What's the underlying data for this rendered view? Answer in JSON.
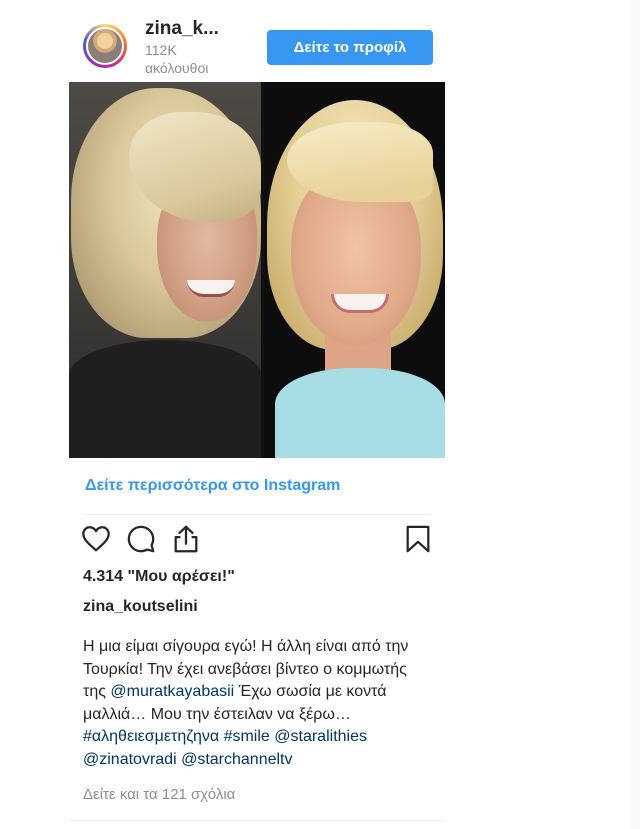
{
  "header": {
    "username": "zina_k...",
    "followers_count": "112K",
    "followers_label": "ακόλουθοι",
    "profile_button_label": "Δείτε το προφίλ"
  },
  "links": {
    "see_more": "Δείτε περισσότερα στο Instagram"
  },
  "actions": {
    "icons": [
      "heart-icon",
      "comment-icon",
      "share-icon",
      "bookmark-icon"
    ]
  },
  "post": {
    "likes": "4.314 \"Μου αρέσει!\"",
    "author": "zina_koutselini",
    "caption": {
      "segments": [
        {
          "type": "text",
          "text": "Η μια είμαι σίγουρα εγώ! Η άλλη είναι από την Τουρκία! Την έχει ανεβάσει βίντεο ο κομμωτής της "
        },
        {
          "type": "link",
          "text": "@muratkayabasii"
        },
        {
          "type": "text",
          "text": " Έχω σωσία με κοντά μαλλιά… Μου την έστειλαν να ξέρω… "
        },
        {
          "type": "link",
          "text": "#αληθειεσμετηζηνα"
        },
        {
          "type": "text",
          "text": " "
        },
        {
          "type": "link",
          "text": "#smile"
        },
        {
          "type": "text",
          "text": " "
        },
        {
          "type": "link",
          "text": "@staralithies"
        },
        {
          "type": "text",
          "text": " "
        },
        {
          "type": "link",
          "text": "@zinatovradi"
        },
        {
          "type": "text",
          "text": " "
        },
        {
          "type": "link",
          "text": "@starchanneltv"
        }
      ]
    },
    "comments_link": "Δείτε και τα 121 σχόλια"
  },
  "colors": {
    "accent_blue": "#3897f0",
    "link_dark_blue": "#003569",
    "muted_gray": "#8e8e8e",
    "text": "#262626"
  }
}
